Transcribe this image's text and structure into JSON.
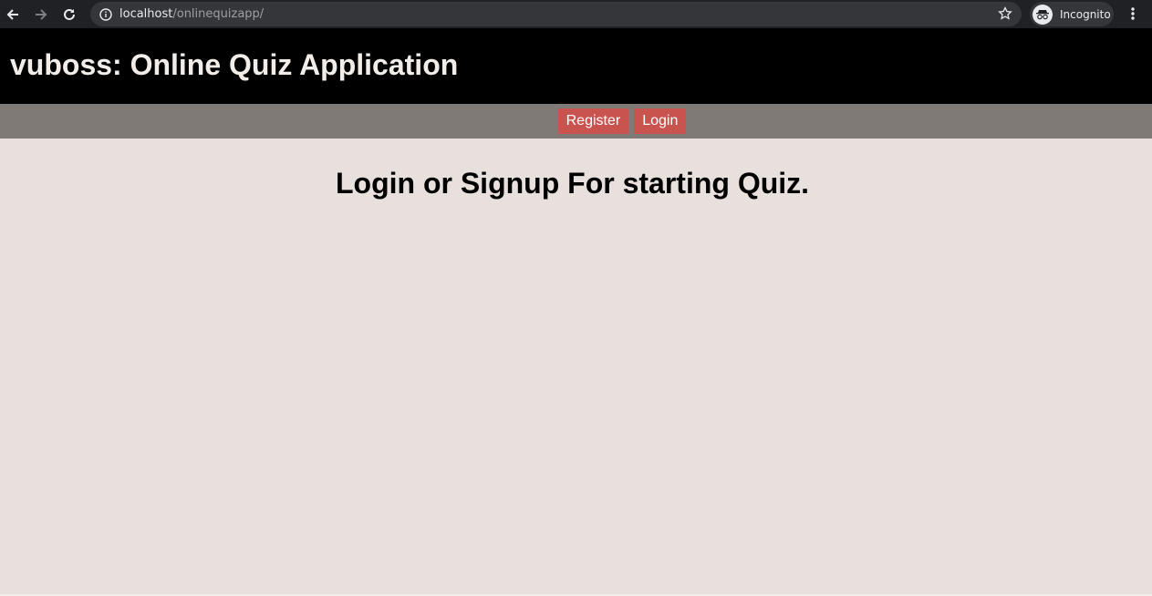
{
  "browser": {
    "url_host": "localhost",
    "url_path": "/onlinequizapp/",
    "profile_label": "Incognito"
  },
  "header": {
    "title": "vuboss: Online Quiz Application"
  },
  "nav": {
    "register_label": "Register",
    "login_label": "Login"
  },
  "main": {
    "heading": "Login or Signup For starting Quiz."
  },
  "colors": {
    "header_bg": "#000000",
    "nav_bg": "#7f7a76",
    "button_bg": "#c9534f",
    "page_bg": "#e8e0dc"
  }
}
